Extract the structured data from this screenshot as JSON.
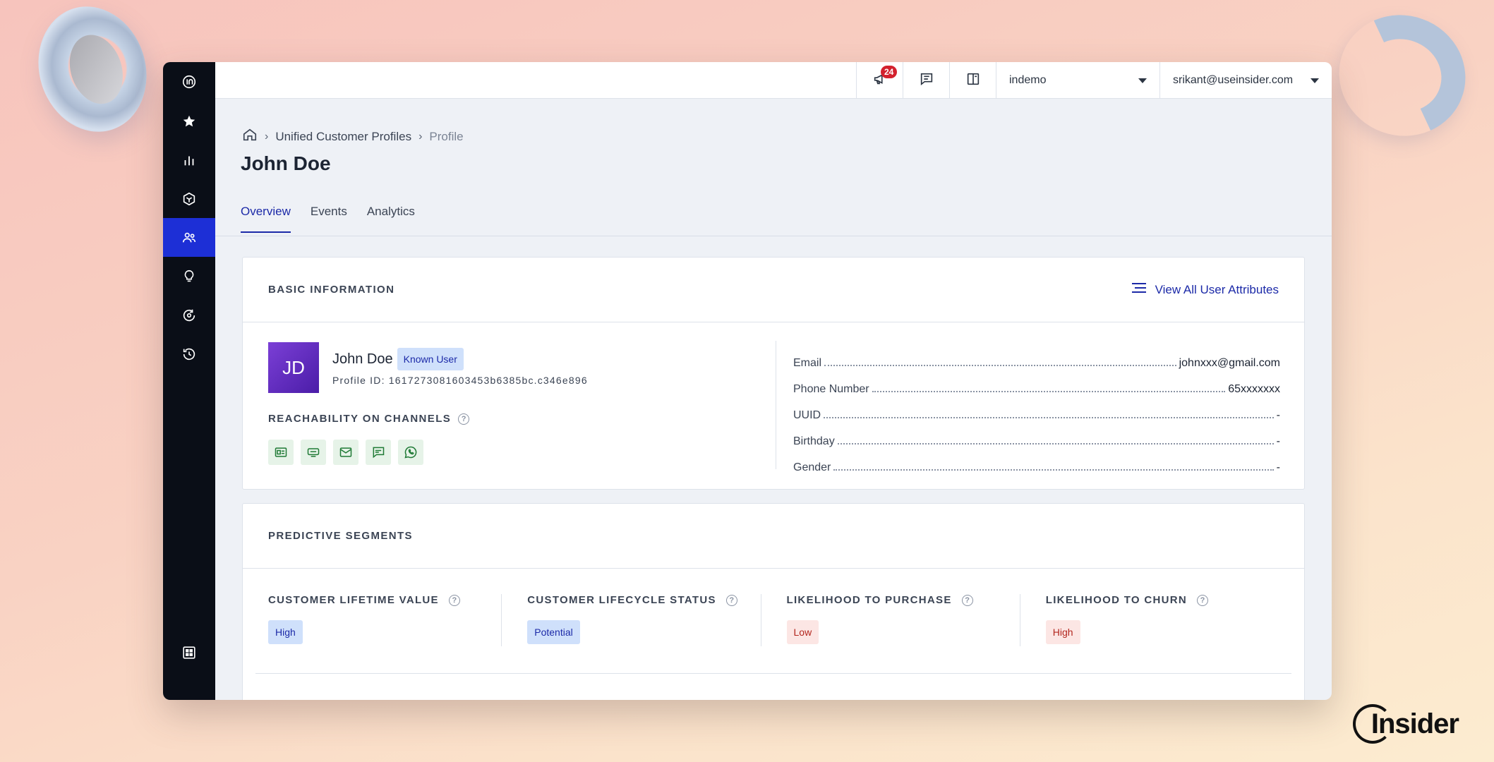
{
  "topbar": {
    "notifications_count": "24",
    "account": "indemo",
    "user_email": "srikant@useinsider.com"
  },
  "sidebar": {
    "items": [
      {
        "icon": "insider-logo-icon"
      },
      {
        "icon": "star-icon"
      },
      {
        "icon": "bar-chart-icon"
      },
      {
        "icon": "cube-icon"
      },
      {
        "icon": "users-icon",
        "active": true
      },
      {
        "icon": "lightbulb-icon"
      },
      {
        "icon": "refresh-circle-icon"
      },
      {
        "icon": "history-icon"
      },
      {
        "icon": "grid-apps-icon"
      }
    ]
  },
  "breadcrumb": {
    "items": [
      "Unified Customer Profiles",
      "Profile"
    ]
  },
  "page": {
    "title": "John Doe",
    "tabs": [
      "Overview",
      "Events",
      "Analytics"
    ],
    "active_tab": "Overview"
  },
  "basic_info": {
    "title": "BASIC INFORMATION",
    "view_all": "View All User Attributes",
    "avatar_initials": "JD",
    "name": "John Doe",
    "badge": "Known User",
    "profile_id": "Profile ID: 1617273081603453b6385bc.c346e896",
    "reachability_title": "REACHABILITY ON CHANNELS",
    "channels": [
      "web-push-icon",
      "app-push-icon",
      "email-icon",
      "sms-icon",
      "whatsapp-icon"
    ],
    "attributes": [
      {
        "label": "Email",
        "value": "johnxxx@gmail.com"
      },
      {
        "label": "Phone Number",
        "value": "65xxxxxxx"
      },
      {
        "label": "UUID",
        "value": "-"
      },
      {
        "label": "Birthday",
        "value": "-"
      },
      {
        "label": "Gender",
        "value": "-"
      }
    ]
  },
  "predictive": {
    "title": "PREDICTIVE SEGMENTS",
    "segments": [
      {
        "label": "CUSTOMER LIFETIME VALUE",
        "value": "High",
        "tone": "#1c2aa8"
      },
      {
        "label": "CUSTOMER LIFECYCLE STATUS",
        "value": "Potential",
        "tone": "#1c2aa8"
      },
      {
        "label": "LIKELIHOOD TO PURCHASE",
        "value": "Low",
        "tone": "#b3261e"
      },
      {
        "label": "LIKELIHOOD TO CHURN",
        "value": "High",
        "tone": "#b3261e"
      }
    ]
  },
  "brand": {
    "name": "Insider"
  },
  "colors": {
    "accent": "#1c2aa8",
    "sidebar_active": "#1d2fd6",
    "sidebar_bg": "#0a0e17"
  }
}
